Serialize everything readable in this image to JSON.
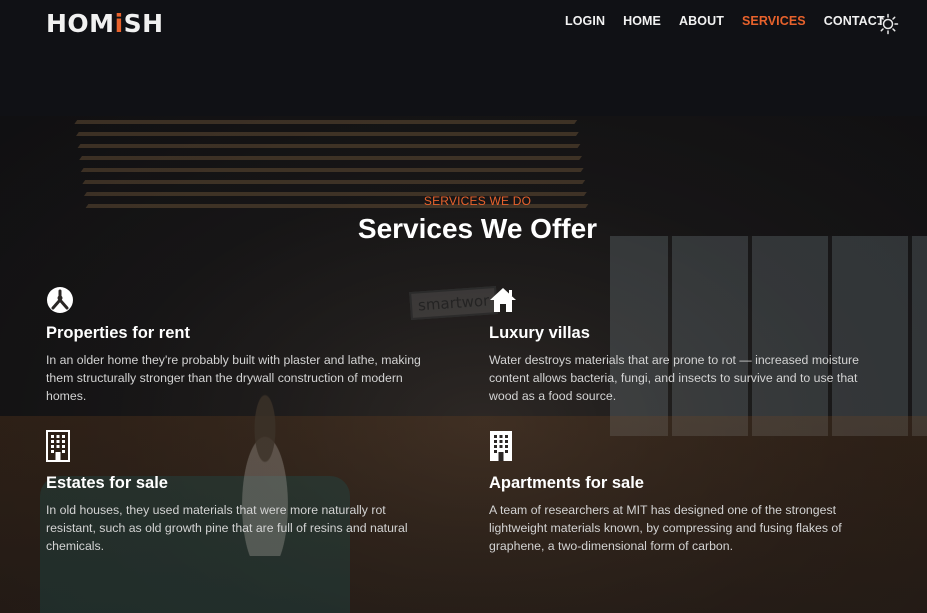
{
  "brand": {
    "name_part1": "HOM",
    "name_accent": "i",
    "name_part2": "SH",
    "accent_color": "#e8622c"
  },
  "nav": {
    "items": [
      {
        "label": "LOGIN",
        "active": false
      },
      {
        "label": "HOME",
        "active": false
      },
      {
        "label": "ABOUT",
        "active": false
      },
      {
        "label": "SERVICES",
        "active": true
      },
      {
        "label": "CONTACT",
        "active": false
      }
    ],
    "theme_icon": "sun-icon"
  },
  "hero": {
    "sign_text": "smartwor"
  },
  "services": {
    "kicker": "SERVICES WE DO",
    "title": "Services We Offer",
    "items": [
      {
        "icon": "compass-icon",
        "title": "Properties for rent",
        "text": "In an older home they're probably built with plaster and lathe, making them structurally stronger than the drywall construction of modern homes."
      },
      {
        "icon": "house-icon",
        "title": "Luxury villas",
        "text": "Water destroys materials that are prone to rot — increased moisture content allows bacteria, fungi, and insects to survive and to use that wood as a food source."
      },
      {
        "icon": "building-icon",
        "title": "Estates for sale",
        "text": "In old houses, they used materials that were more naturally rot resistant, such as old growth pine that are full of resins and natural chemicals."
      },
      {
        "icon": "apartment-icon",
        "title": "Apartments for sale",
        "text": "A team of researchers at MIT has designed one of the strongest lightweight materials known, by compressing and fusing flakes of graphene, a two-dimensional form of carbon."
      }
    ]
  }
}
